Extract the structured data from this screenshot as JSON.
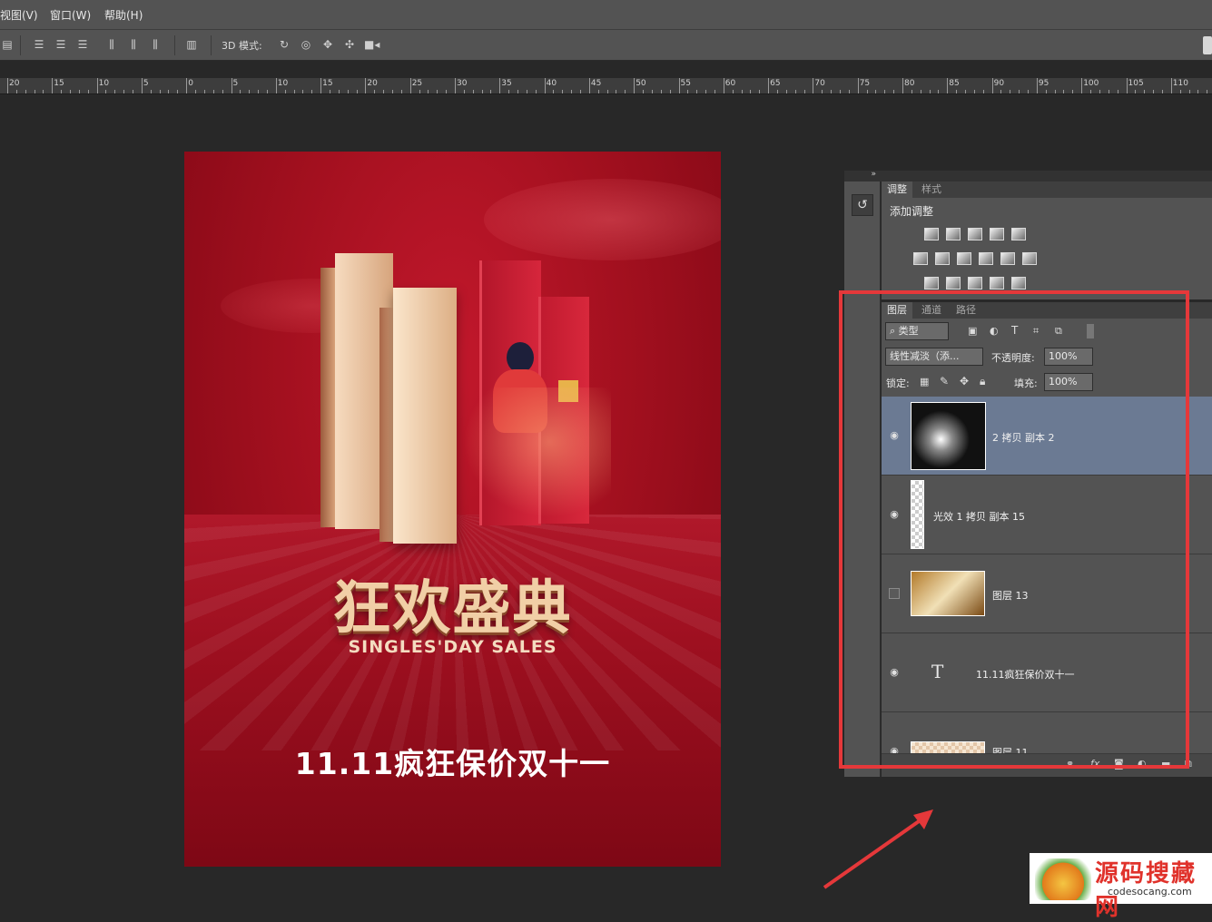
{
  "menu": {
    "view": "视图(V)",
    "window": "窗口(W)",
    "help": "帮助(H)"
  },
  "options_bar": {
    "mode_label": "3D 模式:"
  },
  "ruler": {
    "labels": [
      "20",
      "15",
      "10",
      "5",
      "0",
      "5",
      "10",
      "15",
      "20",
      "25",
      "30",
      "35",
      "40",
      "45",
      "50",
      "55",
      "60",
      "65",
      "70",
      "75",
      "80",
      "85",
      "90",
      "95",
      "100",
      "105",
      "110"
    ]
  },
  "poster": {
    "title_cn": "狂欢盛典",
    "title_en": "SINGLES'DAY SALES",
    "promo": "11.11疯狂保价双十一",
    "colors": {
      "background": "#a3101f",
      "gold": "#f1cfa6"
    }
  },
  "adjustments_panel": {
    "tabs": [
      "调整",
      "样式"
    ],
    "active_tab": "调整",
    "heading": "添加调整",
    "icons": [
      "brightness-icon",
      "levels-icon",
      "curves-icon",
      "exposure-icon",
      "vibrance-icon",
      "hue-saturation-icon",
      "color-balance-icon",
      "black-white-icon",
      "photo-filter-icon",
      "channel-mixer-icon",
      "color-lookup-icon",
      "invert-icon",
      "posterize-icon",
      "threshold-icon",
      "selective-color-icon",
      "gradient-map-icon"
    ]
  },
  "layers_panel": {
    "tabs": [
      "图层",
      "通道",
      "路径"
    ],
    "active_tab": "图层",
    "filter_kind": "类型",
    "blend_mode": "线性减淡（添...",
    "opacity_label": "不透明度:",
    "opacity_value": "100%",
    "lock_label": "锁定:",
    "fill_label": "填充:",
    "fill_value": "100%",
    "layers": [
      {
        "name": "2 拷贝 副本 2",
        "visible": true,
        "selected": true,
        "kind": "pixel"
      },
      {
        "name": "光效 1 拷贝 副本 15",
        "visible": true,
        "selected": false,
        "kind": "pixel"
      },
      {
        "name": "图层 13",
        "visible": false,
        "selected": false,
        "kind": "pixel"
      },
      {
        "name": "11.11疯狂保价双十一",
        "visible": true,
        "selected": false,
        "kind": "text"
      },
      {
        "name": "图层 11",
        "visible": true,
        "selected": false,
        "kind": "pixel"
      }
    ],
    "text_glyph": "T"
  },
  "watermark": {
    "title": "源码搜藏网",
    "url": "codesocang.com"
  },
  "annotation": {
    "highlight_color": "#e5383a"
  }
}
